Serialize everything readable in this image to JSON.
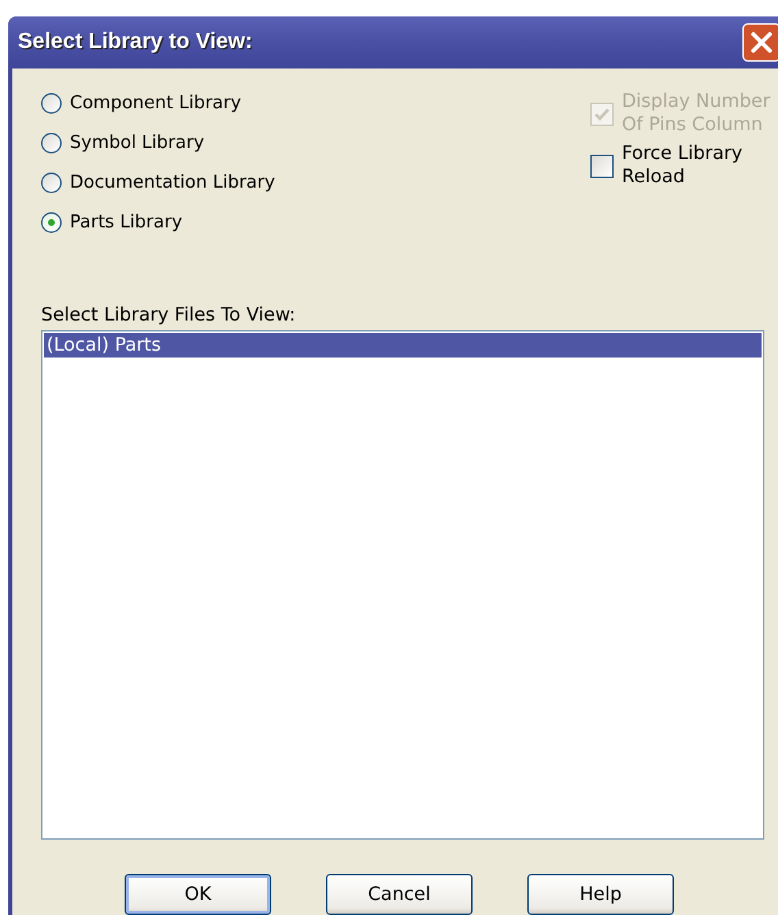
{
  "window": {
    "title": "Select Library to View:"
  },
  "library_types": [
    {
      "label": "Component Library",
      "selected": false
    },
    {
      "label": "Symbol Library",
      "selected": false
    },
    {
      "label": "Documentation Library",
      "selected": false
    },
    {
      "label": "Parts Library",
      "selected": true
    }
  ],
  "options": [
    {
      "label": "Display Number Of Pins Column",
      "checked": true,
      "disabled": true
    },
    {
      "label": "Force Library Reload",
      "checked": false,
      "disabled": false
    }
  ],
  "files": {
    "label": "Select Library Files To View:",
    "items": [
      {
        "label": "(Local) Parts",
        "selected": true
      }
    ]
  },
  "buttons": [
    {
      "label": "OK",
      "default": true
    },
    {
      "label": "Cancel",
      "default": false
    },
    {
      "label": "Help",
      "default": false
    }
  ]
}
